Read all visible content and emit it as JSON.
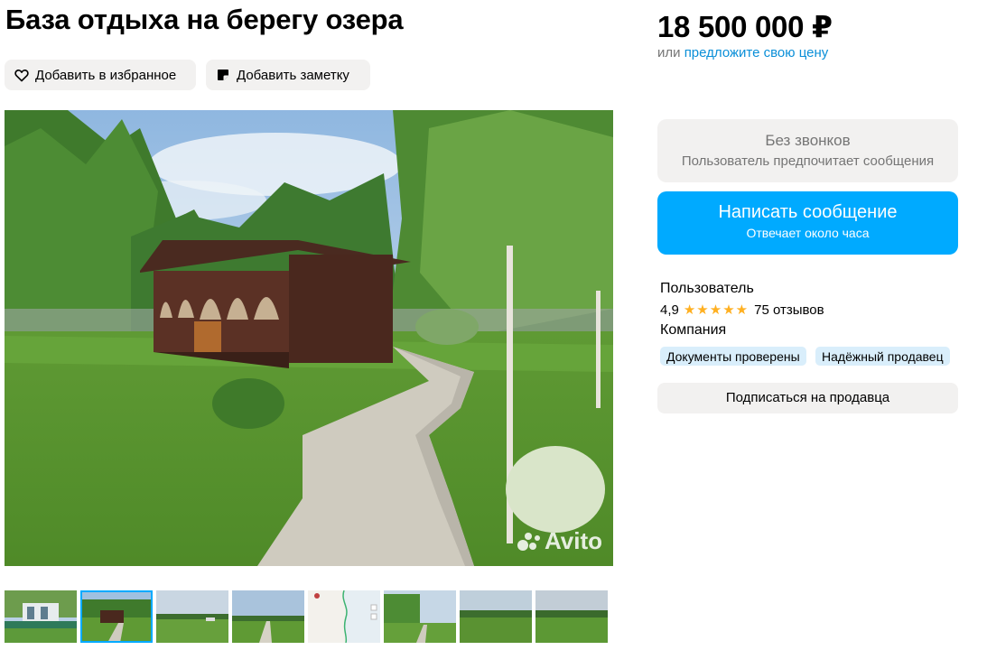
{
  "listing": {
    "title": "База отдыха на берегу озера",
    "add_favorite_label": "Добавить в избранное",
    "add_note_label": "Добавить заметку",
    "watermark": "Avito"
  },
  "price": {
    "value": "18 500 000 ₽",
    "or_text": "или",
    "offer_link": "предложите свою цену"
  },
  "contact": {
    "no_calls_title": "Без звонков",
    "no_calls_subtitle": "Пользователь предпочитает сообщения",
    "message_button": "Написать сообщение",
    "message_subtitle": "Отвечает около часа"
  },
  "seller": {
    "type": "Пользователь",
    "rating": "4,9",
    "stars": "★★★★★",
    "reviews": "75 отзывов",
    "kind": "Компания",
    "badges": [
      "Документы проверены",
      "Надёжный продавец"
    ],
    "subscribe_label": "Подписаться на продавца"
  },
  "gallery": {
    "active_index": 1,
    "thumbnail_count": 8
  },
  "icons": {
    "favorite": "heart-icon",
    "note": "note-icon"
  },
  "colors": {
    "accent": "#00aaff",
    "link": "#0a8fd8",
    "button_bg": "#f2f1f0",
    "badge_bg": "#d9eefb",
    "star": "#ffb021"
  }
}
